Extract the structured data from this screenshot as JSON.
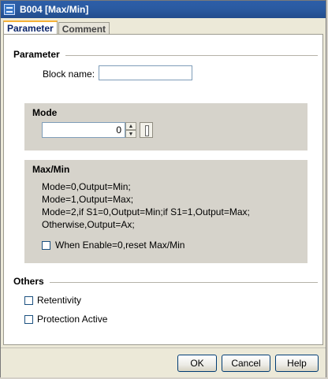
{
  "window": {
    "title": "B004 [Max/Min]",
    "icon": "function-block-icon"
  },
  "tabs": [
    {
      "label": "Parameter",
      "active": true
    },
    {
      "label": "Comment",
      "active": false
    }
  ],
  "parameter": {
    "section_title": "Parameter",
    "block_name_label": "Block name:",
    "block_name_value": ""
  },
  "mode": {
    "title": "Mode",
    "value": "0"
  },
  "maxmin": {
    "title": "Max/Min",
    "lines": [
      "Mode=0,Output=Min;",
      "Mode=1,Output=Max;",
      "Mode=2,if S1=0,Output=Min;if S1=1,Output=Max;",
      "Otherwise,Output=Ax;"
    ],
    "reset_label": "When Enable=0,reset Max/Min",
    "reset_checked": false
  },
  "others": {
    "section_title": "Others",
    "retentivity_label": "Retentivity",
    "retentivity_checked": false,
    "protection_label": "Protection Active",
    "protection_checked": false
  },
  "buttons": {
    "ok": "OK",
    "cancel": "Cancel",
    "help": "Help"
  },
  "colors": {
    "titlebar": "#2a5aa0",
    "active_tab_accent": "#f5b136",
    "group_background": "#d6d3cb"
  }
}
